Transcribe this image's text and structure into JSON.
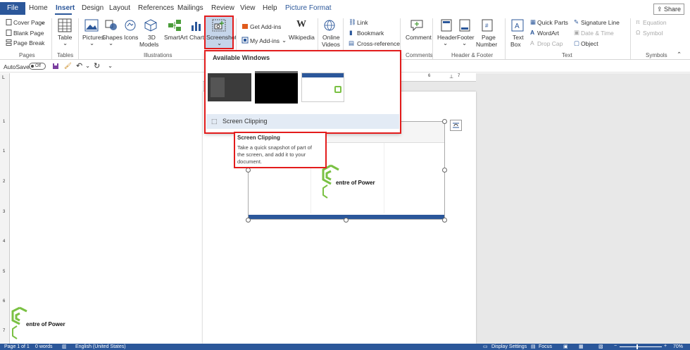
{
  "tabs": {
    "file": "File",
    "home": "Home",
    "insert": "Insert",
    "design": "Design",
    "layout": "Layout",
    "references": "References",
    "mailings": "Mailings",
    "review": "Review",
    "view": "View",
    "help": "Help",
    "picture_format": "Picture Format",
    "share": "Share"
  },
  "ribbon": {
    "pages": {
      "cover": "Cover Page",
      "blank": "Blank Page",
      "break": "Page Break",
      "label": "Pages"
    },
    "tables": {
      "table": "Table",
      "label": "Tables"
    },
    "illustrations": {
      "pictures": "Pictures",
      "shapes": "Shapes",
      "icons": "Icons",
      "models_1": "3D",
      "models_2": "Models",
      "smartart": "SmartArt",
      "chart": "Chart",
      "screenshot": "Screenshot",
      "label": "Illustrations"
    },
    "addins": {
      "get": "Get Add-ins",
      "my": "My Add-ins",
      "wikipedia": "Wikipedia"
    },
    "media": {
      "online_1": "Online",
      "online_2": "Videos"
    },
    "links": {
      "link": "Link",
      "bookmark": "Bookmark",
      "crossref": "Cross-reference"
    },
    "comments": {
      "comment": "Comment",
      "label": "Comments"
    },
    "header_footer": {
      "header": "Header",
      "footer": "Footer",
      "page_1": "Page",
      "page_2": "Number",
      "label": "Header & Footer"
    },
    "text": {
      "textbox_1": "Text",
      "textbox_2": "Box",
      "quick": "Quick Parts",
      "wordart": "WordArt",
      "dropcap": "Drop Cap",
      "sigline": "Signature Line",
      "datetime": "Date & Time",
      "object": "Object",
      "label": "Text"
    },
    "symbols": {
      "equation": "Equation",
      "symbol": "Symbol",
      "label": "Symbols"
    }
  },
  "qat": {
    "autosave": "AutoSave",
    "toggle": "Off"
  },
  "dropdown": {
    "heading": "Available Windows",
    "clip": "Screen Clipping"
  },
  "tooltip": {
    "title": "Screen Clipping",
    "body_1": "Take a quick snapshot of part of",
    "body_2": "the screen, and add it to your",
    "body_3": "document."
  },
  "logo_text": "entre of Power",
  "status": {
    "page": "Page 1 of 1",
    "words": "0 words",
    "lang": "English (United States)",
    "display": "Display Settings",
    "focus": "Focus",
    "zoom": "70%"
  },
  "colors": {
    "accent": "#2b579a",
    "highlight": "#e31c1c",
    "logo_green": "#7ac143"
  }
}
